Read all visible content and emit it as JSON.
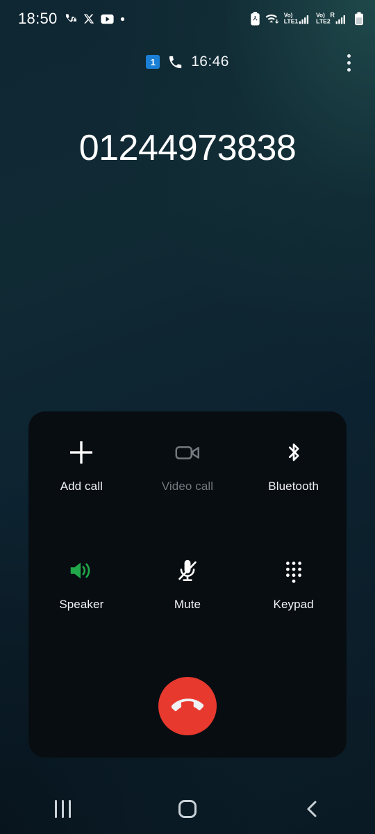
{
  "status_bar": {
    "time": "18:50",
    "left_icons": [
      "missed-call-lock-icon",
      "x-twitter-icon",
      "youtube-icon",
      "notification-dot-icon"
    ],
    "right_icons": [
      "battery-saver-icon",
      "wifi-data-icon",
      "volte1-signal-icon",
      "volte2-roaming-signal-icon",
      "battery-icon"
    ],
    "network_labels": [
      "Vo)",
      "LTE1",
      "Vo)",
      "LTE2",
      "R"
    ]
  },
  "call": {
    "sim_badge": "1",
    "duration": "16:46",
    "phone_number": "01244973838",
    "overflow_menu": "more-options"
  },
  "controls": [
    {
      "id": "add-call",
      "label": "Add call",
      "icon": "plus-icon",
      "state": "enabled"
    },
    {
      "id": "video-call",
      "label": "Video call",
      "icon": "video-camera-icon",
      "state": "disabled"
    },
    {
      "id": "bluetooth",
      "label": "Bluetooth",
      "icon": "bluetooth-icon",
      "state": "enabled"
    },
    {
      "id": "speaker",
      "label": "Speaker",
      "icon": "speaker-icon",
      "state": "active"
    },
    {
      "id": "mute",
      "label": "Mute",
      "icon": "microphone-off-icon",
      "state": "enabled"
    },
    {
      "id": "keypad",
      "label": "Keypad",
      "icon": "dialpad-icon",
      "state": "enabled"
    }
  ],
  "end_call": {
    "icon": "end-call-handset-icon",
    "label": "End call"
  },
  "nav_bar": {
    "recents": "recents-icon",
    "home": "home-icon",
    "back": "back-icon"
  },
  "colors": {
    "accent_green": "#21a84a",
    "end_call_red": "#e8392e",
    "sim_blue": "#1c7fd6",
    "panel_bg": "#080d12",
    "disabled_text": "#73797f"
  }
}
